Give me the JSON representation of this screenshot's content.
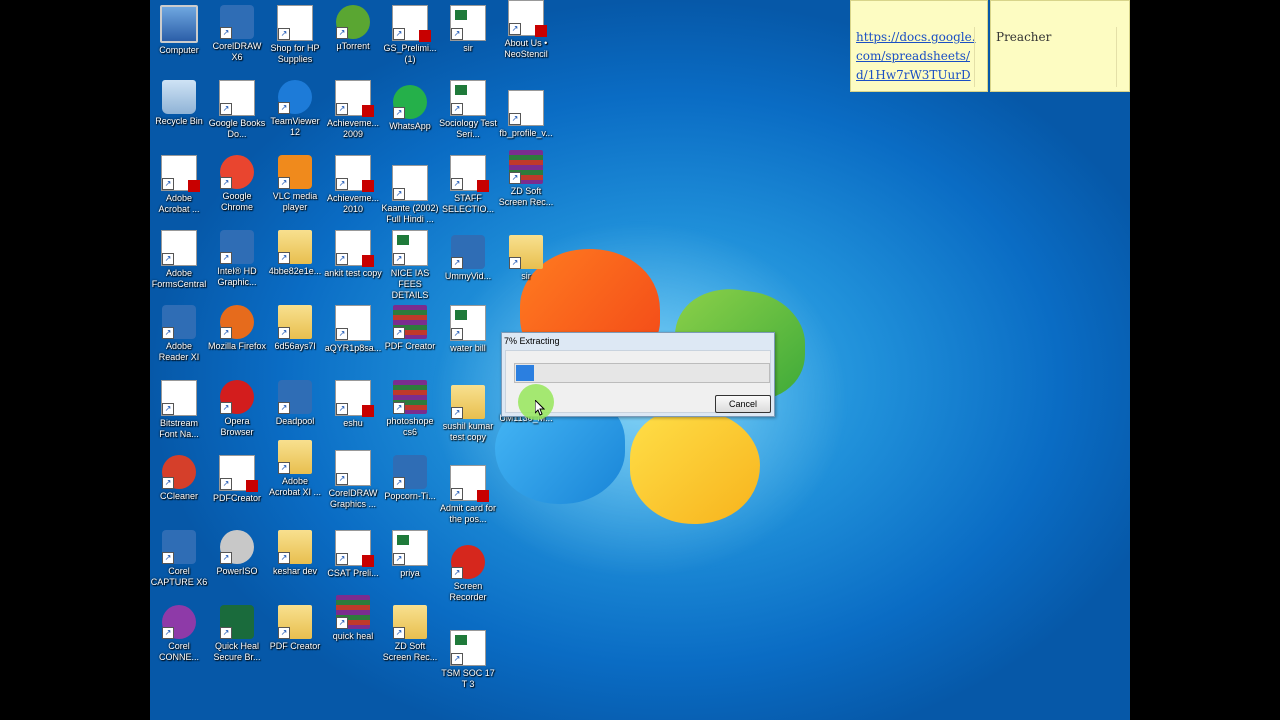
{
  "desktop": {
    "icons": [
      {
        "label": "Computer"
      },
      {
        "label": "CorelDRAW X6"
      },
      {
        "label": "Shop for HP Supplies"
      },
      {
        "label": "µTorrent"
      },
      {
        "label": "GS_Prelimi... (1)"
      },
      {
        "label": "sir"
      },
      {
        "label": "About Us • NeoStencil"
      },
      {
        "label": "Recycle Bin"
      },
      {
        "label": "Google Books Do..."
      },
      {
        "label": "TeamViewer 12"
      },
      {
        "label": "Achieveme... 2009"
      },
      {
        "label": "WhatsApp"
      },
      {
        "label": "Sociology Test Seri..."
      },
      {
        "label": "fb_profile_v..."
      },
      {
        "label": "Adobe Acrobat ..."
      },
      {
        "label": "Google Chrome"
      },
      {
        "label": "VLC media player"
      },
      {
        "label": "Achieveme... 2010"
      },
      {
        "label": "Kaante (2002) Full Hindi ..."
      },
      {
        "label": "STAFF SELECTIO..."
      },
      {
        "label": "ZD Soft Screen Rec..."
      },
      {
        "label": "Adobe FormsCentral"
      },
      {
        "label": "Intel® HD Graphic..."
      },
      {
        "label": "4bbe82e1e..."
      },
      {
        "label": "ankit test copy"
      },
      {
        "label": "NICE IAS FEES DETAILS"
      },
      {
        "label": "UmmyVid..."
      },
      {
        "label": "sir"
      },
      {
        "label": "Adobe Reader XI"
      },
      {
        "label": "Mozilla Firefox"
      },
      {
        "label": "6d56ays7l"
      },
      {
        "label": "aQYR1p8sa..."
      },
      {
        "label": "PDF Creator"
      },
      {
        "label": "water bill"
      },
      {
        "label": "Bitstream Font Na..."
      },
      {
        "label": "Opera Browser"
      },
      {
        "label": "Deadpool"
      },
      {
        "label": "eshu"
      },
      {
        "label": "photoshope cs6"
      },
      {
        "label": "sushil kumar test copy"
      },
      {
        "label": "UM1130_M..."
      },
      {
        "label": "CCleaner"
      },
      {
        "label": "PDFCreator"
      },
      {
        "label": "Adobe Acrobat XI ..."
      },
      {
        "label": "CorelDRAW Graphics ..."
      },
      {
        "label": "Popcorn-Ti..."
      },
      {
        "label": "Admit card for the pos..."
      },
      {
        "label": "Corel CAPTURE X6"
      },
      {
        "label": "PowerISO"
      },
      {
        "label": "keshar dev"
      },
      {
        "label": "CSAT Preli..."
      },
      {
        "label": "priya"
      },
      {
        "label": "Screen Recorder"
      },
      {
        "label": "Corel CONNE..."
      },
      {
        "label": "Quick Heal Secure Br..."
      },
      {
        "label": "PDF Creator"
      },
      {
        "label": "quick heal"
      },
      {
        "label": "ZD Soft Screen Rec..."
      },
      {
        "label": "TSM SOC 17 T 3"
      }
    ]
  },
  "sticky_notes": [
    {
      "text": "https://docs.google.com/spreadsheets/d/1Hw7rW3TUurD"
    },
    {
      "text": "Preacher"
    }
  ],
  "sticky_link_lines": [
    "https://docs.google.",
    "com/spreadsheets/",
    "d/1Hw7rW3TUurD"
  ],
  "dialog": {
    "title": "7% Extracting",
    "progress_percent": 7,
    "cancel_label": "Cancel"
  },
  "colors": {
    "progress_fill": "#2b7fe0",
    "sticky_bg": "#fdfcc2",
    "link": "#1a4fc4"
  }
}
